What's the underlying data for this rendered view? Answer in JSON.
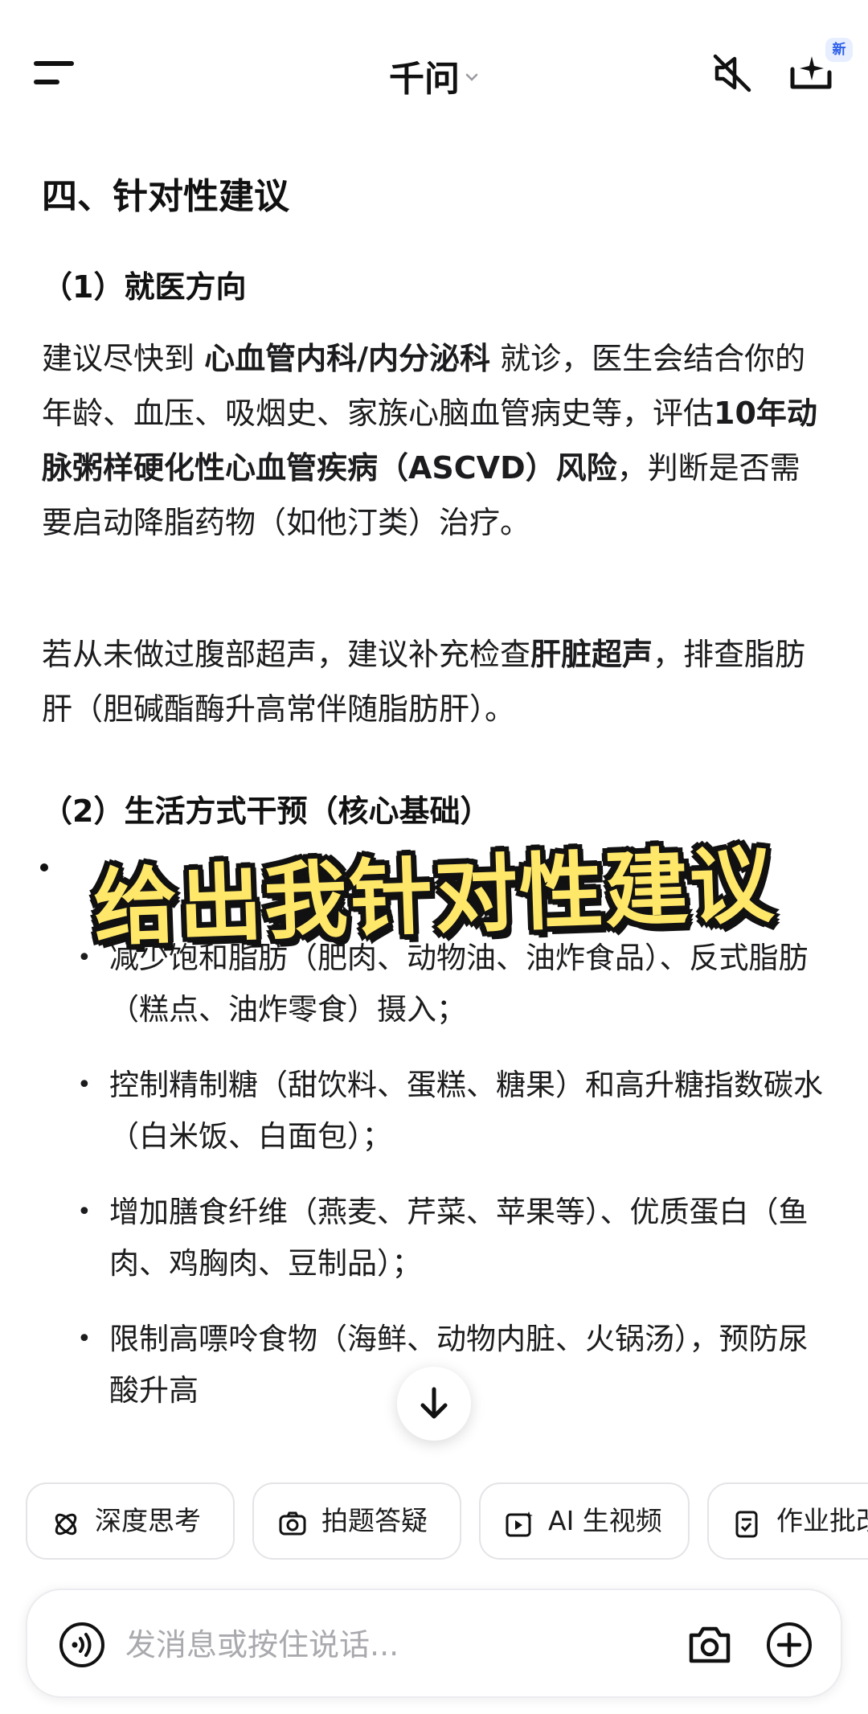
{
  "header": {
    "title": "千问",
    "new_badge": "新",
    "icons": [
      "menu-icon",
      "chevron-down-icon",
      "mute-icon",
      "new-chat-icon"
    ]
  },
  "content": {
    "section_title": "四、针对性建议",
    "sub1_title": "（1）就医方向",
    "para1": [
      {
        "text": "建议尽快到 ",
        "bold": false
      },
      {
        "text": "心血管内科/内分泌科",
        "bold": true
      },
      {
        "text": " 就诊，医生会结合你的年龄、血压、吸烟史、家族心脑血管病史等，评估",
        "bold": false
      },
      {
        "text": "10年动脉粥样硬化性心血管疾病（ASCVD）风险",
        "bold": true
      },
      {
        "text": "，判断是否需要启动降脂药物（如他汀类）治疗。",
        "bold": false
      }
    ],
    "para2": [
      {
        "text": "若从未做过腹部超声，建议补充检查",
        "bold": false
      },
      {
        "text": "肝脏超声",
        "bold": true
      },
      {
        "text": "，排查脂肪肝（胆碱酯酶升高常伴随脂肪肝）。",
        "bold": false
      }
    ],
    "sub2_title": "（2）生活方式干预（核心基础）",
    "bullets": [
      "减少饱和脂肪（肥肉、动物油、油炸食品）、反式脂肪（糕点、油炸零食）摄入；",
      "控制精制糖（甜饮料、蛋糕、糖果）和高升糖指数碳水（白米饭、白面包）；",
      "增加膳食纤维（燕麦、芹菜、苹果等）、优质蛋白（鱼肉、鸡胸肉、豆制品）；",
      "限制高嘌呤食物（海鲜、动物内脏、火锅汤），预防尿酸升高"
    ],
    "overlay_caption": "给出我针对性建议"
  },
  "chips": [
    {
      "label": "深度思考",
      "icon": "deep-think-icon"
    },
    {
      "label": "拍题答疑",
      "icon": "photo-question-icon"
    },
    {
      "label": "AI 生视频",
      "icon": "ai-video-icon"
    },
    {
      "label": "作业批改",
      "icon": "homework-icon"
    }
  ],
  "input": {
    "placeholder": "发消息或按住说话...",
    "icons": [
      "voice-icon",
      "camera-icon",
      "plus-icon"
    ]
  }
}
